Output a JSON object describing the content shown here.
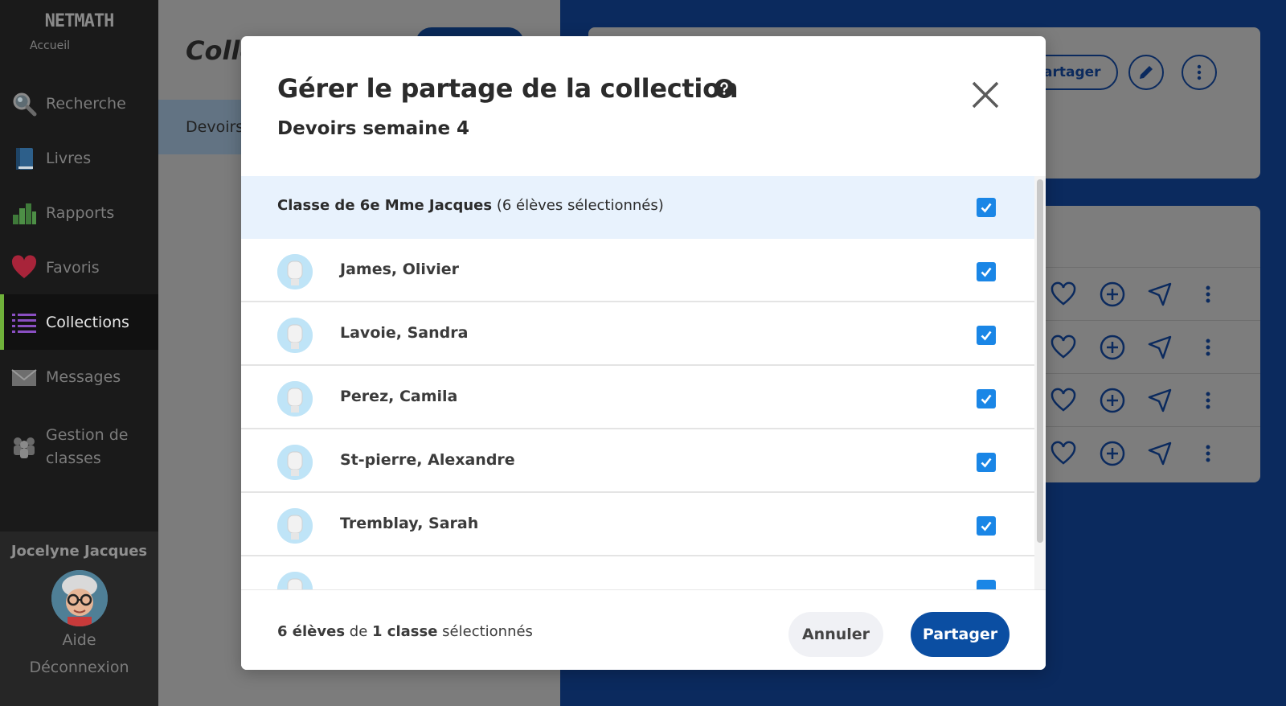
{
  "app": {
    "logo": "NETMATH",
    "home_label": "Accueil"
  },
  "sidebar": {
    "items": [
      {
        "label": "Recherche",
        "icon": "magnifier-icon"
      },
      {
        "label": "Livres",
        "icon": "book-icon"
      },
      {
        "label": "Rapports",
        "icon": "bar-chart-icon"
      },
      {
        "label": "Favoris",
        "icon": "heart-icon"
      },
      {
        "label": "Collections",
        "icon": "list-icon",
        "active": true
      },
      {
        "label": "Messages",
        "icon": "envelope-icon"
      },
      {
        "label_line1": "Gestion de",
        "label_line2": "classes",
        "icon": "people-icon"
      }
    ],
    "user_name": "Jocelyne Jacques",
    "help_label": "Aide",
    "logout_label": "Déconnexion"
  },
  "background": {
    "title": "Colle",
    "tab_label": "Devoirs",
    "share_label": "Partager"
  },
  "modal": {
    "title": "Gérer le partage de la collection",
    "subtitle": "Devoirs semaine 4",
    "class_row": {
      "name": "Classe de 6e Mme Jacques",
      "selection_note": "(6 élèves sélectionnés)",
      "checked": true
    },
    "students": [
      {
        "name": "James, Olivier",
        "checked": true
      },
      {
        "name": "Lavoie, Sandra",
        "checked": true
      },
      {
        "name": "Perez, Camila",
        "checked": true
      },
      {
        "name": "St-pierre, Alexandre",
        "checked": true
      },
      {
        "name": "Tremblay, Sarah",
        "checked": true
      }
    ],
    "footer": {
      "count_students": "6 élèves",
      "word_of": "de",
      "count_classes": "1 classe",
      "word_selected": "sélectionnés",
      "cancel_label": "Annuler",
      "share_label": "Partager"
    }
  },
  "colors": {
    "accent_blue": "#0b4ea2",
    "checkbox_blue": "#1a86e6",
    "class_row_bg": "#e8f2fd",
    "sidebar_bg": "#1a1a1a",
    "active_marker": "#6fb13a"
  }
}
